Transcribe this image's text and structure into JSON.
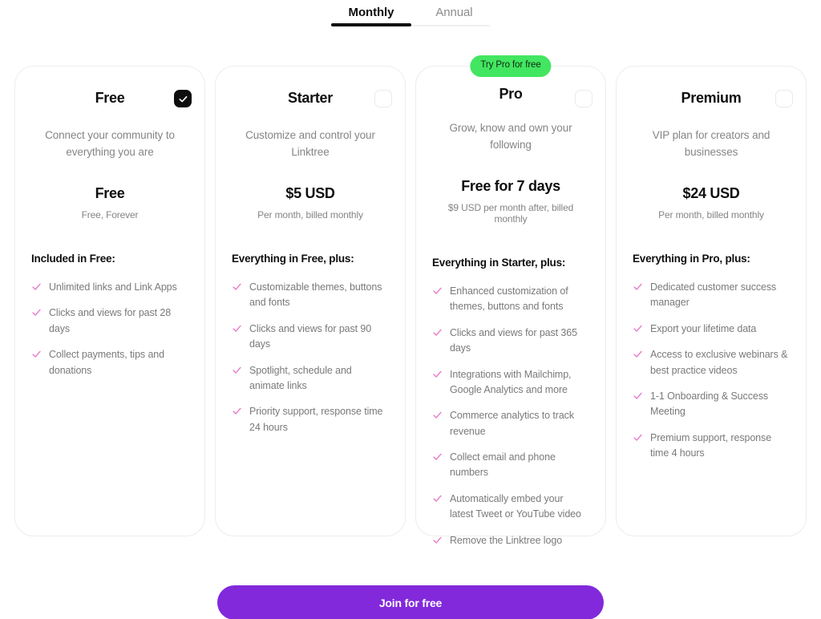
{
  "billing_tabs": {
    "items": [
      {
        "label": "Monthly",
        "active": true
      },
      {
        "label": "Annual",
        "active": false
      }
    ]
  },
  "colors": {
    "badge_green": "#43E660",
    "cta_purple": "#8129DB",
    "check_pink": "#E879C8",
    "text_dark": "#0E0E0E",
    "text_muted": "#858585",
    "card_border": "#EDEDED"
  },
  "plans": [
    {
      "name": "Free",
      "selected": true,
      "checkbox_icon": "check-icon",
      "tagline": "Connect your community to everything you are",
      "price": "Free",
      "price_note": "Free, Forever",
      "features_title": "Included in Free:",
      "features": [
        "Unlimited links and Link Apps",
        "Clicks and views for past 28 days",
        "Collect payments, tips and donations"
      ]
    },
    {
      "name": "Starter",
      "selected": false,
      "tagline": "Customize and control your Linktree",
      "price": "$5 USD",
      "price_note": "Per month, billed monthly",
      "features_title": "Everything in Free, plus:",
      "features": [
        "Customizable themes, buttons and fonts",
        "Clicks and views for past 90 days",
        "Spotlight, schedule and animate links",
        "Priority support, response time 24 hours"
      ]
    },
    {
      "name": "Pro",
      "selected": false,
      "badge": "Try Pro for free",
      "tagline": "Grow, know and own your following",
      "price": "Free for 7 days",
      "price_note": "$9 USD per month after, billed monthly",
      "features_title": "Everything in Starter, plus:",
      "features": [
        "Enhanced customization of themes, buttons and fonts",
        "Clicks and views for past 365 days",
        "Integrations with Mailchimp, Google Analytics and more",
        "Commerce analytics to track revenue",
        "Collect email and phone numbers",
        "Automatically embed your latest Tweet or YouTube video",
        "Remove the Linktree logo"
      ]
    },
    {
      "name": "Premium",
      "selected": false,
      "tagline": "VIP plan for creators and businesses",
      "price": "$24 USD",
      "price_note": "Per month, billed monthly",
      "features_title": "Everything in Pro, plus:",
      "features": [
        "Dedicated customer success manager",
        "Export your lifetime data",
        "Access to exclusive webinars & best practice videos",
        "1-1 Onboarding & Success Meeting",
        "Premium support, response time 4 hours"
      ]
    }
  ],
  "cta": {
    "label": "Join for free"
  }
}
